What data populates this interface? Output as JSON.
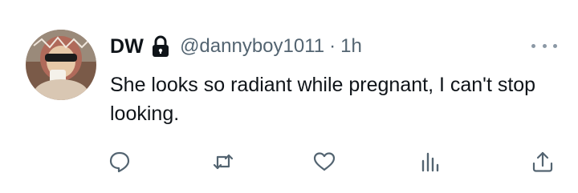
{
  "tweet": {
    "display_name": "DW",
    "handle": "@dannyboy1011",
    "separator": "·",
    "time": "1h",
    "text": "She looks so radiant while pregnant, I can't stop looking."
  },
  "icons": {
    "lock": "lock-icon",
    "more": "more-horizontal-icon",
    "reply": "reply-icon",
    "retweet": "retweet-icon",
    "like": "heart-icon",
    "views": "analytics-icon",
    "share": "share-icon"
  },
  "colors": {
    "text": "#0f1419",
    "secondary": "#536471",
    "icon": "#536471"
  }
}
